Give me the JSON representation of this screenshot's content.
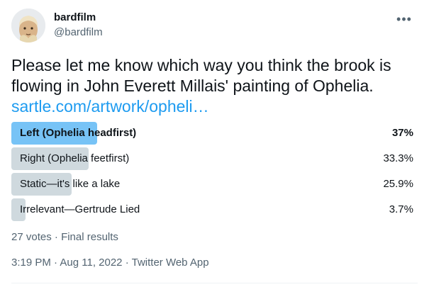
{
  "author": {
    "display_name": "bardfilm",
    "handle": "@bardfilm"
  },
  "more_icon": "more-horizontal-icon",
  "tweet": {
    "text_line1": "Please let me know which way you think the brook is",
    "text_line2": "flowing in John Everett Millais' painting of Ophelia.",
    "link": "sartle.com/artwork/opheli…"
  },
  "poll": {
    "options": [
      {
        "label": "Left (Ophelia headfirst)",
        "percent": "37%",
        "value": 37,
        "winner": true
      },
      {
        "label": "Right (Ophelia feetfirst)",
        "percent": "33.3%",
        "value": 33.3,
        "winner": false
      },
      {
        "label": "Static—it's like a lake",
        "percent": "25.9%",
        "value": 25.9,
        "winner": false
      },
      {
        "label": "Irrelevant—Gertrude Lied",
        "percent": "3.7%",
        "value": 3.7,
        "winner": false
      }
    ],
    "votes": "27 votes",
    "separator": "·",
    "status": "Final results"
  },
  "meta": {
    "time": "3:19 PM",
    "separator": "·",
    "date": "Aug 11, 2022",
    "source": "Twitter Web App"
  },
  "colors": {
    "winner_bar": "#1d9bf0",
    "other_bar": "#cfd9de",
    "link": "#1d9bf0",
    "secondary_text": "#536471"
  }
}
